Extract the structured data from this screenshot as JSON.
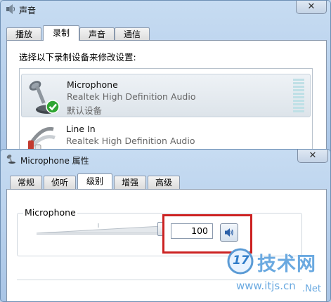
{
  "sound_window": {
    "title": "声音",
    "close_label": "✕",
    "tabs": [
      "播放",
      "录制",
      "声音",
      "通信"
    ],
    "active_tab": "录制",
    "instruction": "选择以下录制设备来修改设置:",
    "devices": [
      {
        "name": "Microphone",
        "driver": "Realtek High Definition Audio",
        "status": "默认设备"
      },
      {
        "name": "Line In",
        "driver": "Realtek High Definition Audio",
        "status": ""
      }
    ]
  },
  "props_window": {
    "title": "Microphone 属性",
    "close_label": "✕",
    "tabs": [
      "常规",
      "侦听",
      "级别",
      "增强",
      "高级"
    ],
    "active_tab": "级别",
    "group_label": "Microphone",
    "volume_value": "100",
    "slider_level": 1.0
  },
  "watermark": {
    "brand": "技术网",
    "logo_number": "17",
    "url": "www.itjs.cn",
    "suffix": ".Net"
  }
}
